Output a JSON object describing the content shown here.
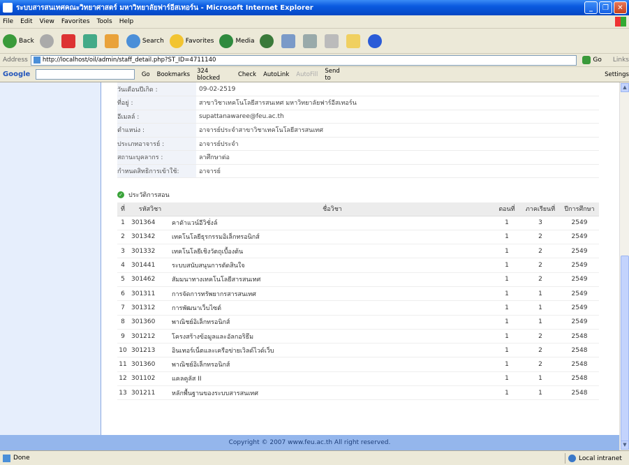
{
  "window": {
    "title": "ระบบสารสนเทศคณะวิทยาศาสตร์ มหาวิทยาลัยฟาร์อีสเทอร์น - Microsoft Internet Explorer",
    "controls": [
      "_",
      "❐",
      "✕"
    ]
  },
  "menu": [
    "File",
    "Edit",
    "View",
    "Favorites",
    "Tools",
    "Help"
  ],
  "toolbar": {
    "back": "Back",
    "search": "Search",
    "favorites": "Favorites",
    "media": "Media"
  },
  "address": {
    "label": "Address",
    "url": "http://localhost/oil/admin/staff_detail.php?ST_ID=4711140",
    "go": "Go",
    "links": "Links"
  },
  "googlebar": {
    "brand": "Google",
    "go": "Go",
    "bookmarks": "Bookmarks",
    "blocked": "324 blocked",
    "check": "Check",
    "autolink": "AutoLink",
    "autofill": "AutoFill",
    "sendto": "Send to",
    "settings": "Settings"
  },
  "info": [
    {
      "label": "วันเดือนปีเกิด :",
      "value": "09-02-2519"
    },
    {
      "label": "ที่อยู่ :",
      "value": "สาขาวิชาเทคโนโลยีสารสนเทศ มหาวิทยาลัยฟาร์อีสเทอร์น"
    },
    {
      "label": "อีเมลล์ :",
      "value": "supattanawaree@feu.ac.th"
    },
    {
      "label": "ตำแหน่ง :",
      "value": "อาจารย์ประจำสาขาวิชาเทคโนโลยีสารสนเทศ"
    },
    {
      "label": "ประเภทอาจารย์ :",
      "value": "อาจารย์ประจำ"
    },
    {
      "label": "สถานะบุคลากร :",
      "value": "ลาศึกษาต่อ"
    },
    {
      "label": "กำหนดสิทธิการเข้าใช้:",
      "value": "อาจารย์"
    }
  ],
  "section": {
    "title": "ประวัติการสอน"
  },
  "courses": {
    "headers": [
      "ที่",
      "รหัสวิชา",
      "ชื่อวิชา",
      "ตอนที่",
      "ภาคเรียนที่",
      "ปีการศึกษา"
    ],
    "rows": [
      [
        "1",
        "301364",
        "คาดัาแวน์อีวิชั่งล์",
        "1",
        "3",
        "2549"
      ],
      [
        "2",
        "301342",
        "เทคโนโลยีธุรกรรมอิเล็กทรอนิกส์",
        "1",
        "2",
        "2549"
      ],
      [
        "3",
        "301332",
        "เทคโนโลยีเชิงวัตถุเบื้องต้น",
        "1",
        "2",
        "2549"
      ],
      [
        "4",
        "301441",
        "ระบบสนับสนุนการตัดสินใจ",
        "1",
        "2",
        "2549"
      ],
      [
        "5",
        "301462",
        "สัมมนาทางเทคโนโลยีสารสนเทศ",
        "1",
        "2",
        "2549"
      ],
      [
        "6",
        "301311",
        "การจัดการทรัพยากรสารสนเทศ",
        "1",
        "1",
        "2549"
      ],
      [
        "7",
        "301312",
        "การพัฒนาเว็บไซต์",
        "1",
        "1",
        "2549"
      ],
      [
        "8",
        "301360",
        "พาณิชย์อิเล็กทรอนิกส์",
        "1",
        "1",
        "2549"
      ],
      [
        "9",
        "301212",
        "โครงสร้างข้อมูลและอัลกอริธึม",
        "1",
        "2",
        "2548"
      ],
      [
        "10",
        "301213",
        "อินเทอร์เน็ตและเครือข่ายเวิลด์ไวด์เว็บ",
        "1",
        "2",
        "2548"
      ],
      [
        "11",
        "301360",
        "พาณิชย์อิเล็กทรอนิกส์",
        "1",
        "2",
        "2548"
      ],
      [
        "12",
        "301102",
        "แคลคูลัส II",
        "1",
        "1",
        "2548"
      ],
      [
        "13",
        "301211",
        "หลักพื้นฐานของระบบสารสนเทศ",
        "1",
        "1",
        "2548"
      ]
    ]
  },
  "footer": {
    "copyright": "Copyright © 2007 www.feu.ac.th All right reserved."
  },
  "status": {
    "left": "Done",
    "zone": "Local intranet"
  }
}
